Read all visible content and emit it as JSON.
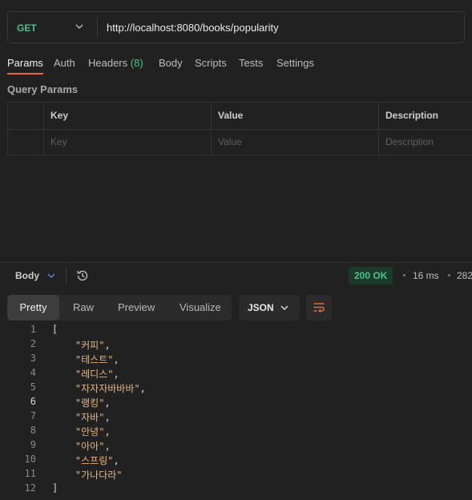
{
  "request": {
    "method": "GET",
    "url": "http://localhost:8080/books/popularity"
  },
  "request_tabs": [
    {
      "label": "Params",
      "active": true
    },
    {
      "label": "Auth"
    },
    {
      "label": "Headers",
      "count": "(8)"
    },
    {
      "label": "Body"
    },
    {
      "label": "Scripts"
    },
    {
      "label": "Tests"
    },
    {
      "label": "Settings"
    }
  ],
  "query_params": {
    "title": "Query Params",
    "headers": [
      "Key",
      "Value",
      "Description"
    ],
    "placeholders": [
      "Key",
      "Value",
      "Description"
    ]
  },
  "response": {
    "section_label": "Body",
    "status": "200 OK",
    "time": "16 ms",
    "size": "282",
    "view_tabs": [
      "Pretty",
      "Raw",
      "Preview",
      "Visualize"
    ],
    "active_view": "Pretty",
    "format": "JSON",
    "lines": [
      {
        "n": "1",
        "text": "["
      },
      {
        "n": "2",
        "text": "    \"커피\","
      },
      {
        "n": "3",
        "text": "    \"테스트\","
      },
      {
        "n": "4",
        "text": "    \"레디스\","
      },
      {
        "n": "5",
        "text": "    \"자자자바바바\","
      },
      {
        "n": "6",
        "text": "    \"랭킹\","
      },
      {
        "n": "7",
        "text": "    \"자바\","
      },
      {
        "n": "8",
        "text": "    \"안녕\","
      },
      {
        "n": "9",
        "text": "    \"아아\","
      },
      {
        "n": "10",
        "text": "    \"스프링\","
      },
      {
        "n": "11",
        "text": "    \"가나다라\""
      },
      {
        "n": "12",
        "text": "]"
      }
    ]
  },
  "colors": {
    "accent": "#e9683f",
    "method": "#4cc38a",
    "string": "#e3b48b"
  }
}
